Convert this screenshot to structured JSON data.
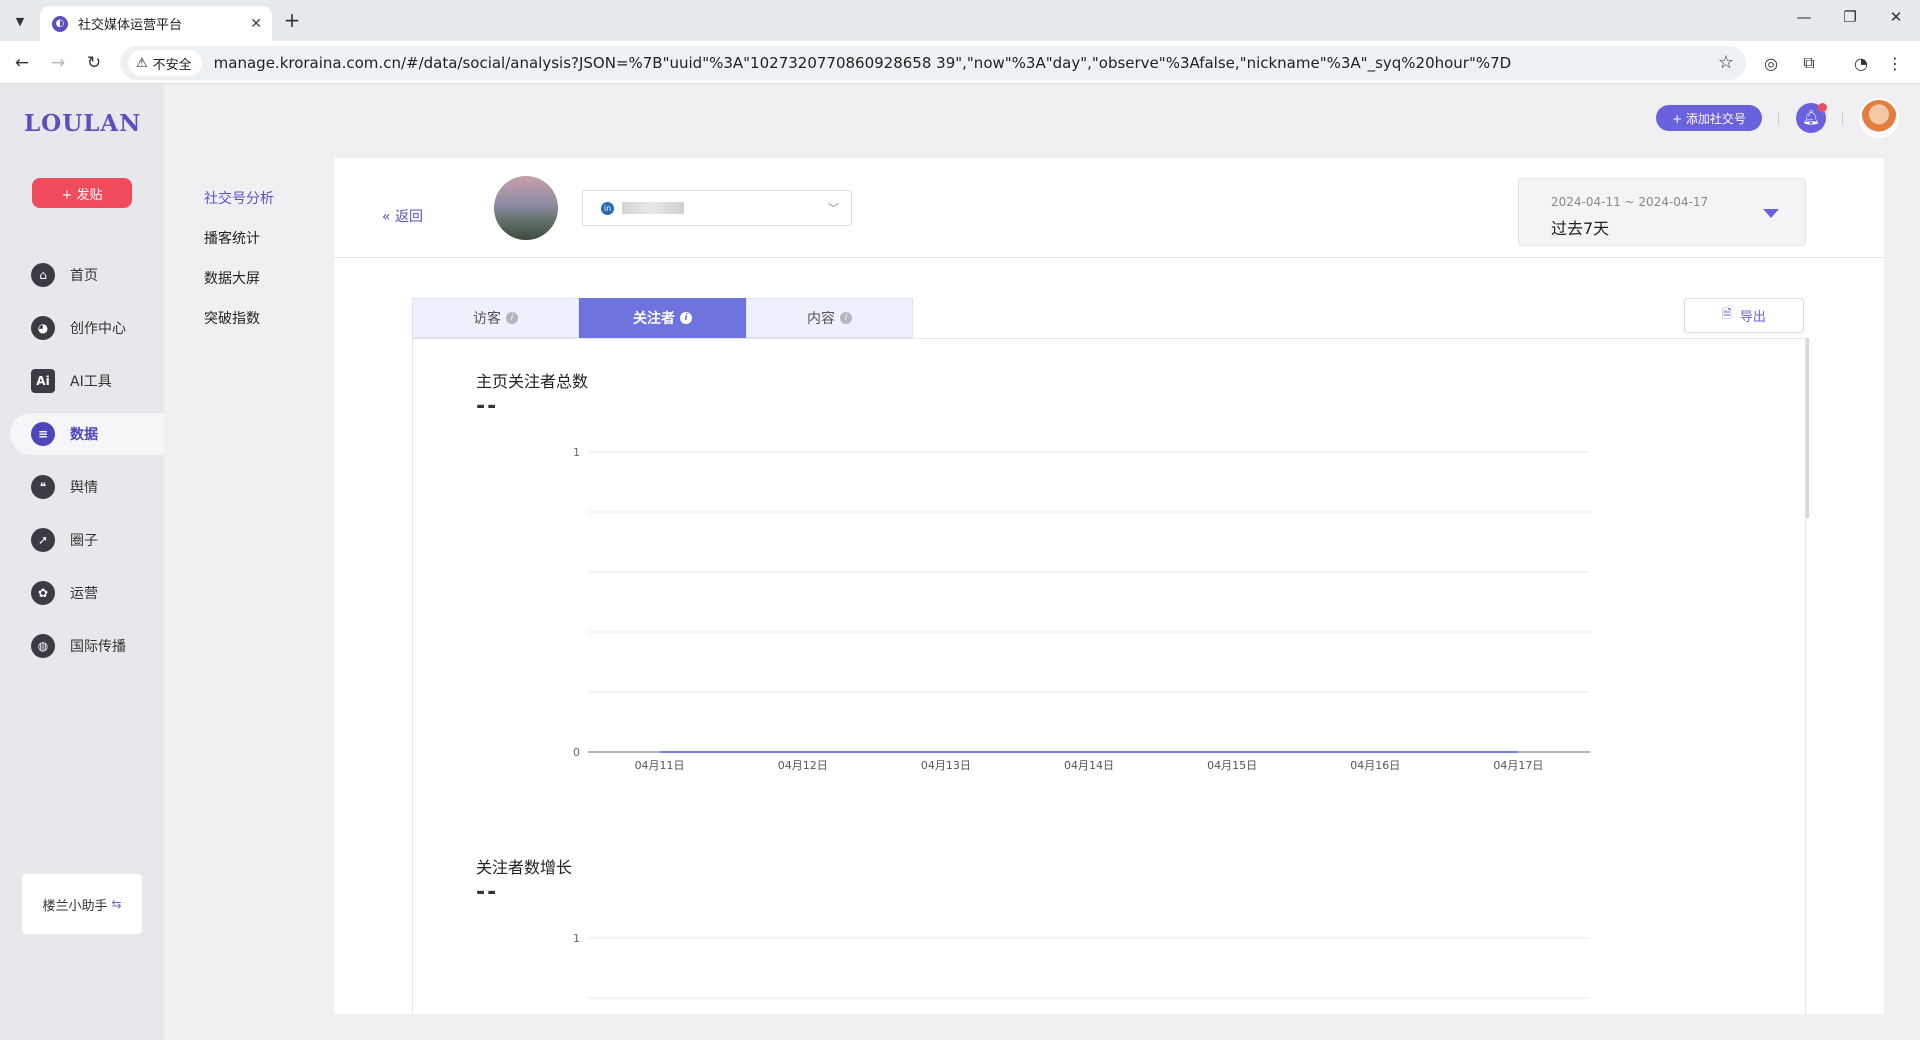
{
  "browser": {
    "tab_title": "社交媒体运营平台",
    "security_label": "不安全",
    "url": "manage.kroraina.com.cn/#/data/social/analysis?JSON=%7B\"uuid\"%3A\"1027320770860928658 39\",\"now\"%3A\"day\",\"observe\"%3Afalse,\"nickname\"%3A\"_syq%20hour\"%7D"
  },
  "sidebar": {
    "logo": "LOULAN",
    "post_button": "+ 发贴",
    "items": [
      {
        "label": "首页",
        "icon": "home-icon"
      },
      {
        "label": "创作中心",
        "icon": "palette-icon"
      },
      {
        "label": "AI工具",
        "icon": "ai-icon"
      },
      {
        "label": "数据",
        "icon": "database-icon"
      },
      {
        "label": "舆情",
        "icon": "quote-icon"
      },
      {
        "label": "圈子",
        "icon": "compass-icon"
      },
      {
        "label": "运营",
        "icon": "gear-icon"
      },
      {
        "label": "国际传播",
        "icon": "globe-icon"
      }
    ],
    "active_index": 3,
    "helper": "楼兰小助手"
  },
  "subnav": {
    "items": [
      "社交号分析",
      "播客统计",
      "数据大屏",
      "突破指数"
    ],
    "active_index": 0
  },
  "header": {
    "add_social": "+ 添加社交号"
  },
  "panel": {
    "back": "« 返回",
    "account_network": "in",
    "date_range": "2024-04-11 ~ 2024-04-17",
    "date_label": "过去7天",
    "tabs": [
      "访客",
      "关注者",
      "内容"
    ],
    "active_tab": 1,
    "export": "导出"
  },
  "metrics": [
    {
      "title": "主页关注者总数",
      "value": "--"
    },
    {
      "title": "关注者数增长",
      "value": "--"
    }
  ],
  "chart_data": [
    {
      "type": "line",
      "title": "主页关注者总数",
      "categories": [
        "04月11日",
        "04月12日",
        "04月13日",
        "04月14日",
        "04月15日",
        "04月16日",
        "04月17日"
      ],
      "series": [
        {
          "values": [
            0,
            0,
            0,
            0,
            0,
            0,
            0
          ]
        }
      ],
      "ylim": [
        0,
        1
      ],
      "yticks": [
        "1",
        "0"
      ],
      "grid": true,
      "line_color": "#3b5fd9"
    },
    {
      "type": "line",
      "title": "关注者数增长",
      "categories": [],
      "series": [],
      "ylim": [
        0,
        1
      ],
      "yticks": [
        "1"
      ],
      "grid": true
    }
  ]
}
